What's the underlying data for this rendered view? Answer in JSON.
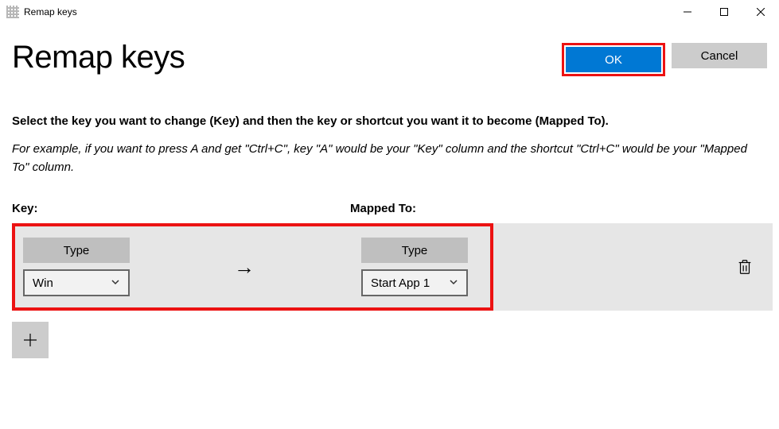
{
  "titlebar": {
    "text": "Remap keys"
  },
  "header": {
    "title": "Remap keys",
    "ok_label": "OK",
    "cancel_label": "Cancel"
  },
  "intro": {
    "line1": "Select the key you want to change (Key) and then the key or shortcut you want it to become (Mapped To).",
    "line2": "For example, if you want to press A and get \"Ctrl+C\", key \"A\" would be your \"Key\" column and the shortcut \"Ctrl+C\" would be your \"Mapped To\" column."
  },
  "columns": {
    "key": "Key:",
    "mapped": "Mapped To:"
  },
  "row": {
    "key_type_label": "Type",
    "key_value": "Win",
    "mapped_type_label": "Type",
    "mapped_value": "Start App 1"
  }
}
